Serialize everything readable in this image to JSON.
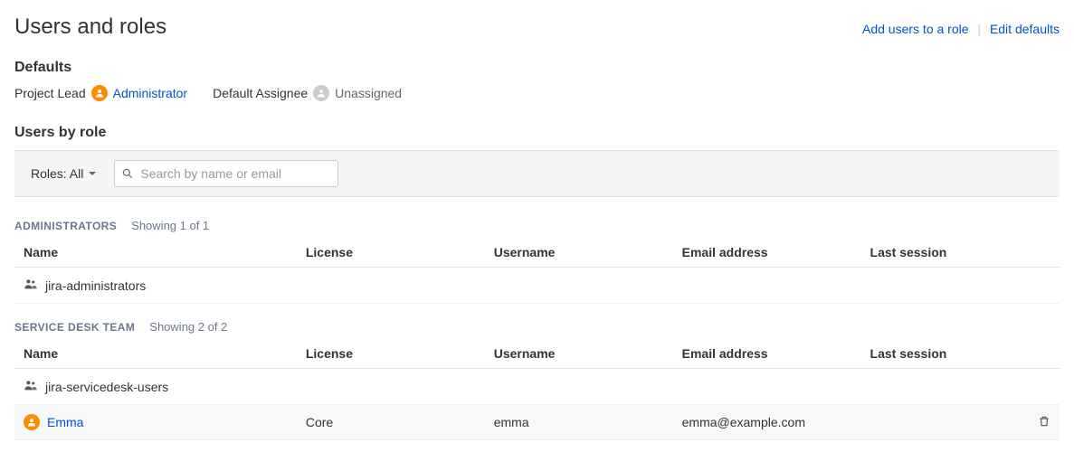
{
  "header": {
    "title": "Users and roles",
    "addUsersLabel": "Add users to a role",
    "editDefaultsLabel": "Edit defaults"
  },
  "defaults": {
    "heading": "Defaults",
    "projectLeadLabel": "Project Lead",
    "projectLeadUser": "Administrator",
    "defaultAssigneeLabel": "Default Assignee",
    "defaultAssigneeValue": "Unassigned"
  },
  "usersByRole": {
    "heading": "Users by role",
    "rolesFilterLabel": "Roles: All",
    "searchPlaceholder": "Search by name or email"
  },
  "columns": {
    "name": "Name",
    "license": "License",
    "username": "Username",
    "email": "Email address",
    "session": "Last session"
  },
  "groups": [
    {
      "title": "ADMINISTRATORS",
      "showing": "Showing 1 of 1",
      "rows": [
        {
          "type": "group",
          "name": "jira-administrators",
          "license": "",
          "username": "",
          "email": "",
          "session": ""
        }
      ]
    },
    {
      "title": "SERVICE DESK TEAM",
      "showing": "Showing 2 of 2",
      "rows": [
        {
          "type": "group",
          "name": "jira-servicedesk-users",
          "license": "",
          "username": "",
          "email": "",
          "session": ""
        },
        {
          "type": "user",
          "name": "Emma",
          "license": "Core",
          "username": "emma",
          "email": "emma@example.com",
          "session": "",
          "deletable": true
        }
      ]
    }
  ]
}
